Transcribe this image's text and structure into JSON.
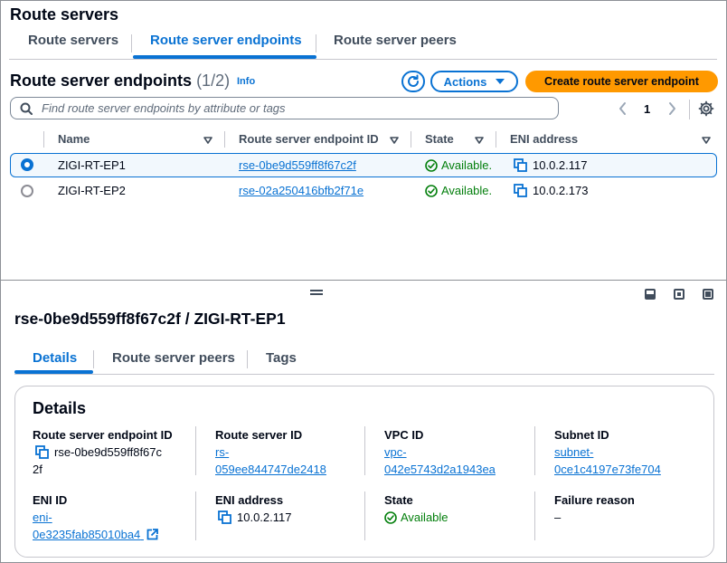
{
  "page": {
    "title": "Route servers"
  },
  "top_tabs": [
    {
      "label": "Route servers"
    },
    {
      "label": "Route server endpoints"
    },
    {
      "label": "Route server peers"
    }
  ],
  "section": {
    "title": "Route server endpoints",
    "count": "(1/2)",
    "info": "Info"
  },
  "toolbar": {
    "actions_label": "Actions",
    "create_label": "Create route server endpoint"
  },
  "search": {
    "placeholder": "Find route server endpoints by attribute or tags"
  },
  "pagination": {
    "current_page": "1"
  },
  "table": {
    "columns": [
      "Name",
      "Route server endpoint ID",
      "State",
      "ENI address"
    ],
    "rows": [
      {
        "name": "ZIGI-RT-EP1",
        "id": "rse-0be9d559ff8f67c2f",
        "state": "Available.",
        "eni": "10.0.2.117",
        "selected": true
      },
      {
        "name": "ZIGI-RT-EP2",
        "id": "rse-02a250416bfb2f71e",
        "state": "Available.",
        "eni": "10.0.2.173",
        "selected": false
      }
    ]
  },
  "detail": {
    "title": "rse-0be9d559ff8f67c2f / ZIGI-RT-EP1",
    "tabs": [
      {
        "label": "Details"
      },
      {
        "label": "Route server peers"
      },
      {
        "label": "Tags"
      }
    ],
    "card_title": "Details",
    "fields": {
      "endpoint_id": {
        "label": "Route server endpoint ID",
        "value_line1": "rse-0be9d559ff8f67c",
        "value_line2": "2f"
      },
      "route_server_id": {
        "label": "Route server ID",
        "value_line1": "rs-",
        "value_line2": "059ee844747de2418"
      },
      "vpc_id": {
        "label": "VPC ID",
        "value_line1": "vpc-",
        "value_line2": "042e5743d2a1943ea"
      },
      "subnet_id": {
        "label": "Subnet ID",
        "value_line1": "subnet-",
        "value_line2": "0ce1c4197e73fe704"
      },
      "eni_id": {
        "label": "ENI ID",
        "value_line1": "eni-",
        "value_line2": "0e3235fab85010ba4"
      },
      "eni_address": {
        "label": "ENI address",
        "value": "10.0.2.117"
      },
      "state": {
        "label": "State",
        "value": "Available"
      },
      "failure_reason": {
        "label": "Failure reason",
        "value": "–"
      }
    }
  },
  "colors": {
    "accent": "#0972d3",
    "primary_button": "#ff9900",
    "success": "#037f0c"
  }
}
